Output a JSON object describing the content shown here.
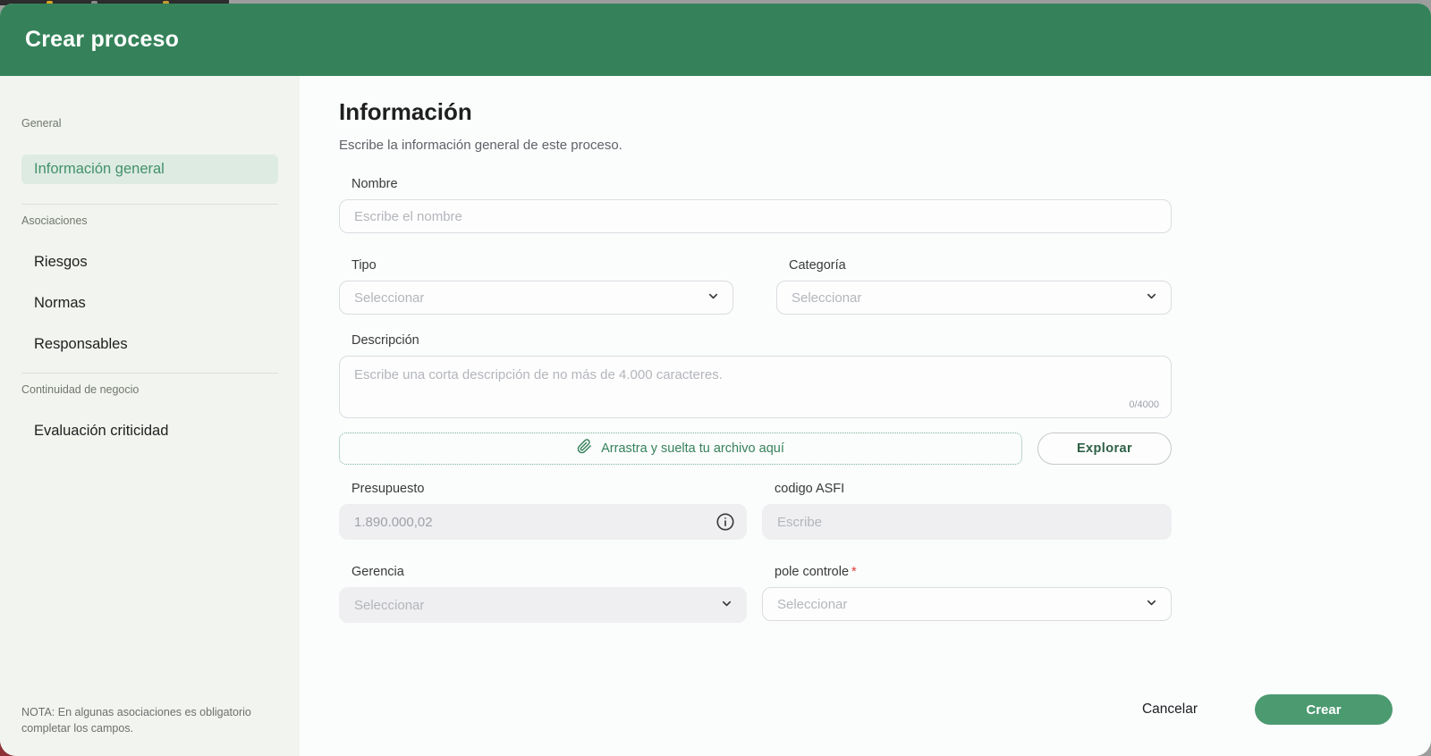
{
  "window": {
    "title": "Crear proceso"
  },
  "sidebar": {
    "sections": [
      {
        "label": "General",
        "items": [
          {
            "label": "Información general",
            "active": true
          }
        ]
      },
      {
        "label": "Asociaciones",
        "items": [
          {
            "label": "Riesgos"
          },
          {
            "label": "Normas"
          },
          {
            "label": "Responsables"
          }
        ]
      },
      {
        "label": "Continuidad de negocio",
        "items": [
          {
            "label": "Evaluación criticidad"
          }
        ]
      }
    ],
    "note": "NOTA: En algunas asociaciones es obligatorio completar los campos."
  },
  "main": {
    "title": "Información",
    "subtitle": "Escribe la información general de este proceso.",
    "fields": {
      "nombre": {
        "label": "Nombre",
        "placeholder": "Escribe el nombre"
      },
      "tipo": {
        "label": "Tipo",
        "value": "Seleccionar"
      },
      "categoria": {
        "label": "Categoría",
        "value": "Seleccionar"
      },
      "descripcion": {
        "label": "Descripción",
        "placeholder": "Escribe una corta descripción de no más de 4.000 caracteres.",
        "counter": "0/4000"
      },
      "archivo": {
        "dropzone_label": "Arrastra y suelta tu archivo aquí",
        "browse_button": "Explorar"
      },
      "presupuesto": {
        "label": "Presupuesto",
        "value": "1.890.000,02"
      },
      "codigo_asfi": {
        "label": "codigo ASFI",
        "placeholder": "Escribe"
      },
      "gerencia": {
        "label": "Gerencia",
        "value": "Seleccionar"
      },
      "pole_controle": {
        "label": "pole controle",
        "required_mark": "*",
        "value": "Seleccionar"
      }
    },
    "footer": {
      "cancel": "Cancelar",
      "create": "Crear"
    }
  },
  "colors": {
    "header_green": "#35825a",
    "accent_green": "#41916b",
    "active_item_bg": "#deebe2",
    "create_button_green": "#4c9a70",
    "required_red": "#e53935",
    "sidebar_bg": "#f1f4ef"
  }
}
